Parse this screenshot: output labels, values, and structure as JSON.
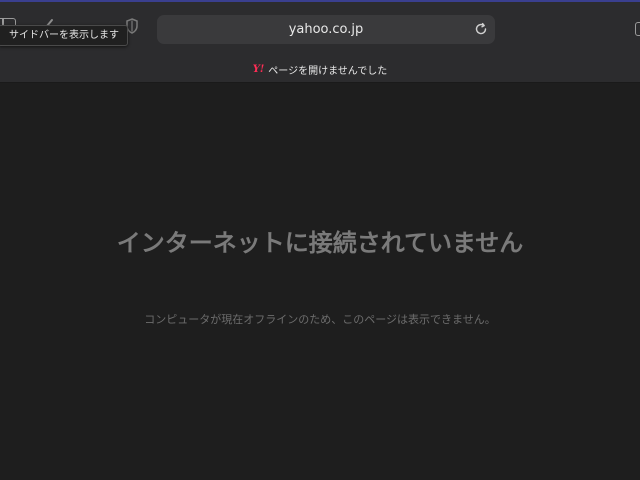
{
  "window": {
    "accent_color": "#3a3f8f",
    "background_color": "#1e1e1e"
  },
  "toolbar": {
    "sidebar_tooltip": "サイドバーを表示します",
    "sidebar_icon": "sidebar-icon",
    "back_icon": "chevron-left-icon",
    "shield_icon": "privacy-shield-icon",
    "reload_icon": "reload-icon"
  },
  "address_bar": {
    "url": "yahoo.co.jp"
  },
  "tab": {
    "favicon_text": "Y!",
    "favicon_color": "#ff2d55",
    "title": "ページを開けませんでした"
  },
  "error_page": {
    "title": "インターネットに接続されていません",
    "description": "コンピュータが現在オフラインのため、このページは表示できません。"
  }
}
